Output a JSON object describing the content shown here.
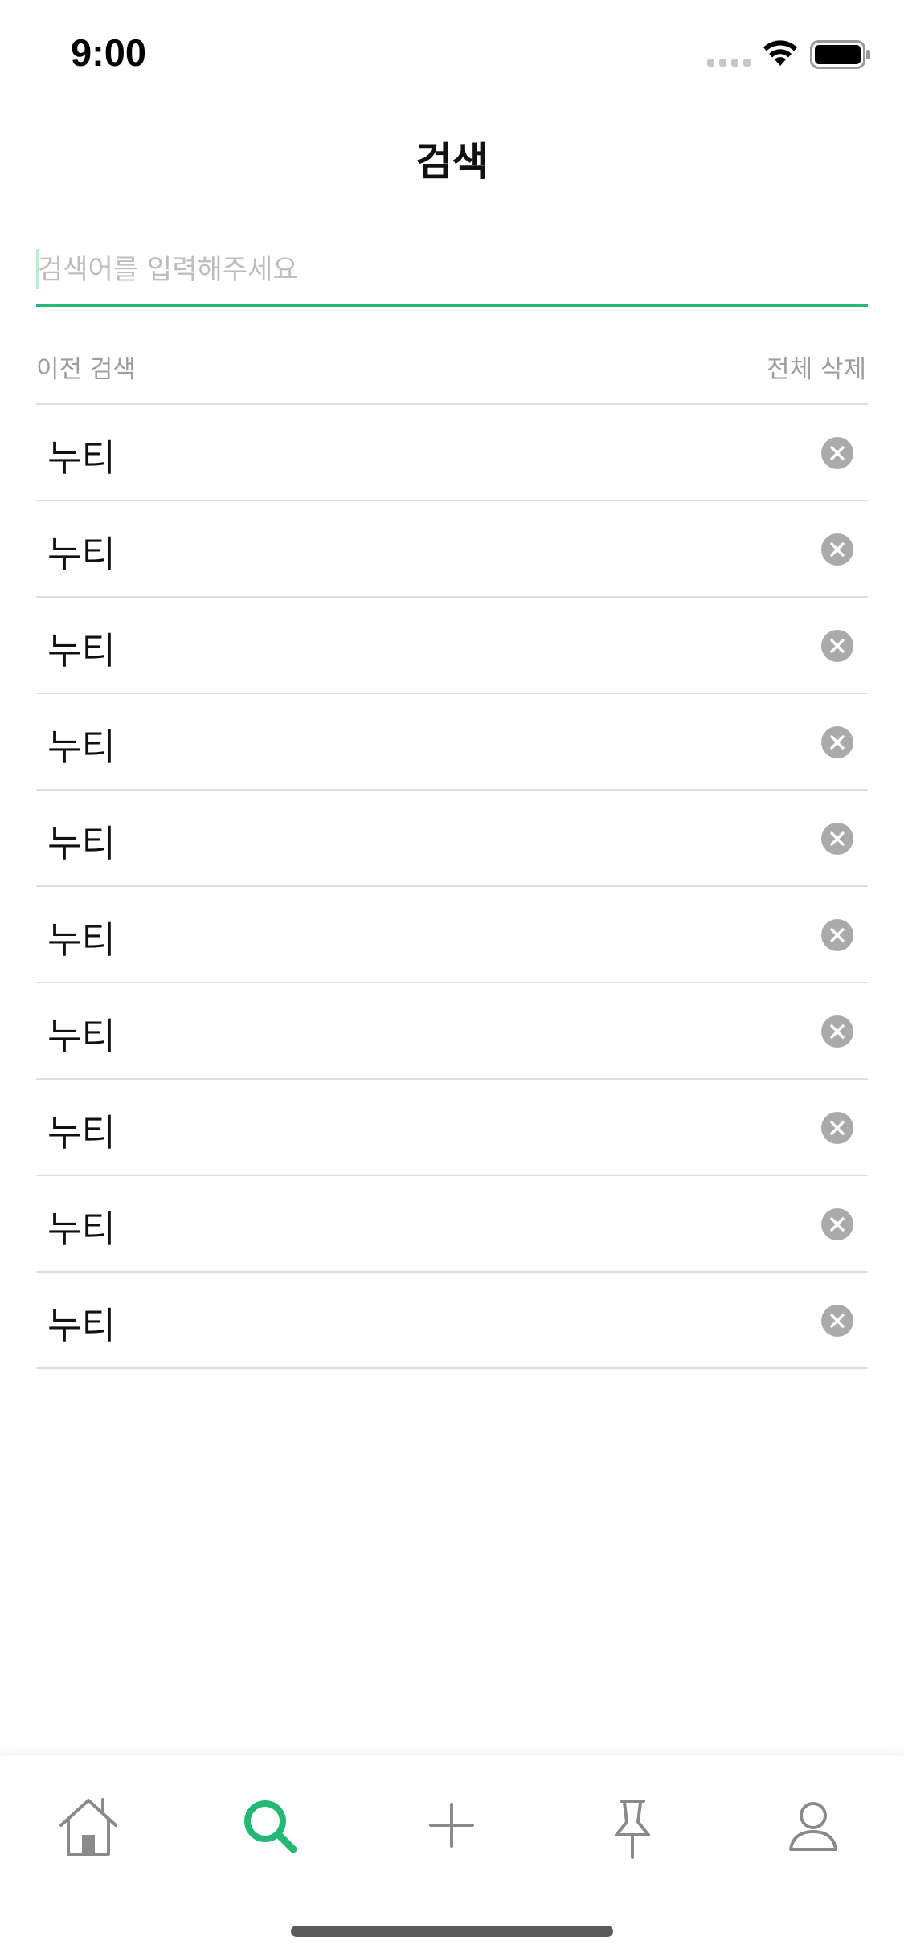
{
  "status_bar": {
    "time": "9:00"
  },
  "header": {
    "title": "검색"
  },
  "search": {
    "placeholder": "검색어를 입력해주세요",
    "value": "",
    "accent_color": "#23b874"
  },
  "history": {
    "section_label": "이전 검색",
    "clear_all_label": "전체 삭제",
    "items": [
      {
        "label": "누티"
      },
      {
        "label": "누티"
      },
      {
        "label": "누티"
      },
      {
        "label": "누티"
      },
      {
        "label": "누티"
      },
      {
        "label": "누티"
      },
      {
        "label": "누티"
      },
      {
        "label": "누티"
      },
      {
        "label": "누티"
      },
      {
        "label": "누티"
      }
    ],
    "remove_icon": "close-circle-icon"
  },
  "tab_bar": {
    "active_color": "#23b874",
    "inactive_color": "#8a8a8a",
    "tabs": [
      {
        "icon": "home-icon",
        "active": false
      },
      {
        "icon": "search-icon",
        "active": true
      },
      {
        "icon": "plus-icon",
        "active": false
      },
      {
        "icon": "pin-icon",
        "active": false
      },
      {
        "icon": "profile-icon",
        "active": false
      }
    ]
  }
}
